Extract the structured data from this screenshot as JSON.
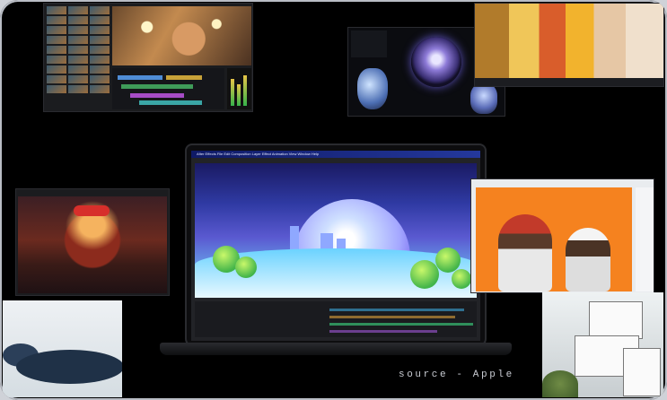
{
  "collage": {
    "caption": "source - Apple"
  },
  "laptop_app": {
    "menu_bar": "After Effects  File  Edit  Composition  Layer  Effect  Animation  View  Window  Help"
  }
}
